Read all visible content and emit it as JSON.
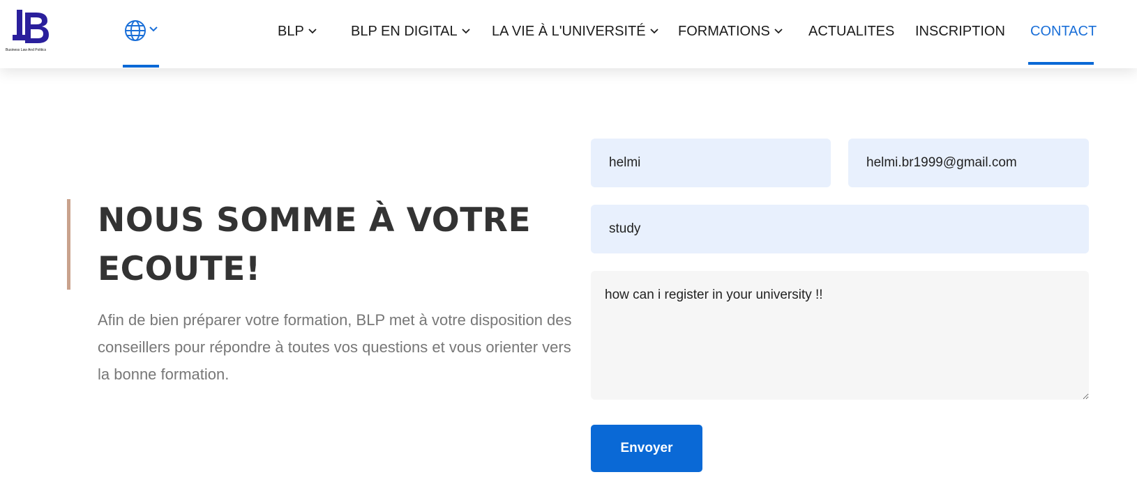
{
  "brand": {
    "logo_text": "Business Law And Politics"
  },
  "language": {
    "icon": "globe-icon",
    "dropdown_icon": "chevron-down-icon"
  },
  "nav": {
    "items": [
      {
        "label": "BLP",
        "has_dropdown": true
      },
      {
        "label": "BLP EN DIGITAL",
        "has_dropdown": true
      },
      {
        "label": "LA VIE À L'UNIVERSITÉ",
        "has_dropdown": true
      },
      {
        "label": "FORMATIONS",
        "has_dropdown": true
      },
      {
        "label": "ACTUALITES",
        "has_dropdown": false
      },
      {
        "label": "INSCRIPTION",
        "has_dropdown": false
      },
      {
        "label": "CONTACT",
        "has_dropdown": false,
        "active": true
      }
    ]
  },
  "hero": {
    "heading": "NOUS SOMME À VOTRE ECOUTE!",
    "description": "Afin de bien préparer votre formation, BLP met à votre disposition des conseillers pour répondre à toutes vos questions et vous orienter vers la bonne formation."
  },
  "form": {
    "name_value": "helmi",
    "email_value": "helmi.br1999@gmail.com",
    "subject_value": "study",
    "message_value": "how can i register in your university !!",
    "submit_label": "Envoyer"
  },
  "colors": {
    "accent": "#0a69d6",
    "input_bg": "#e8f0fd",
    "heading_bar": "#c9a28c",
    "heading": "#333333",
    "body_text": "#777777"
  }
}
